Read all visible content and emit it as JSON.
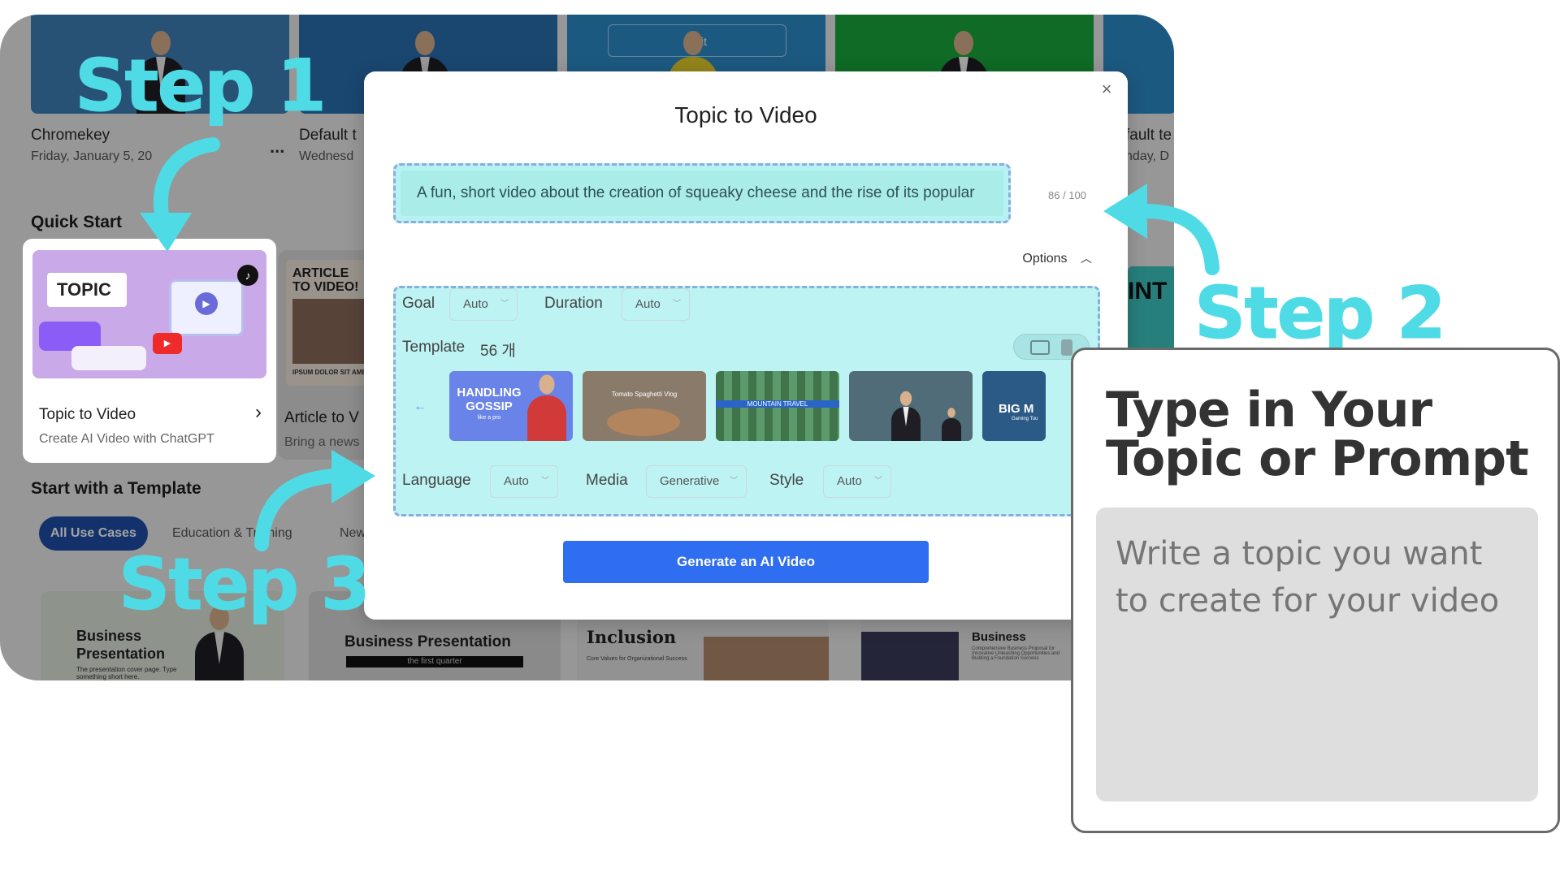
{
  "app": {
    "videos": [
      {
        "title": "Chromekey",
        "date": "Friday, January 5, 20"
      },
      {
        "title": "Default t",
        "date": "Wednesd"
      },
      {
        "title": "fault te",
        "date": "nday, D"
      }
    ],
    "more_label": "...",
    "thumb_edit_label": "Edit",
    "quick_start_title": "Quick Start",
    "quick_cards": [
      {
        "title": "Topic to Video",
        "subtitle": "Create AI Video with ChatGPT",
        "thumb_text": "TOPIC"
      },
      {
        "title": "Article to V",
        "subtitle": "Bring a news",
        "thumb_text": "ARTICLE TO VIDEO!",
        "thumb_caption": "IPSUM DOLOR SIT AME"
      }
    ],
    "side_card_text": "INT",
    "template_section_title": "Start with a Template",
    "template_tabs": [
      "All Use Cases",
      "Education & Training",
      "New"
    ],
    "template_cards": [
      {
        "title": "Business Presentation",
        "subtitle": "The presentation cover page. Type something short here."
      },
      {
        "title": "Business Presentation",
        "subtitle": "the first quarter"
      },
      {
        "title": "Inclusion",
        "subtitle": "Core Values for Organizational Success"
      },
      {
        "title": "Business",
        "subtitle": "Comprehensive Business Proposal for Innovative Unleashing Opportunities and Building a Foundation Success"
      }
    ]
  },
  "steps": {
    "step1": "Step 1",
    "step2": "Step 2",
    "step3": "Step 3"
  },
  "modal": {
    "title": "Topic to Video",
    "close_icon": "×",
    "prompt_text": "A fun, short video about the creation of squeaky cheese and the rise of its popular",
    "char_count": "86 / 100",
    "options_label": "Options",
    "goal_label": "Goal",
    "goal_value": "Auto",
    "duration_label": "Duration",
    "duration_value": "Auto",
    "template_label": "Template",
    "template_count": "56 개",
    "templates": [
      {
        "label": "HANDLING GOSSIP",
        "sub": "like a pro",
        "color": "#6a83e8"
      },
      {
        "label": "Tomato Spaghetti Vlog",
        "color": "#8a7a6a"
      },
      {
        "label": "MOUNTAIN TRAVEL",
        "color": "#4e8a5e"
      },
      {
        "label": "",
        "color": "#4f6c78"
      },
      {
        "label": "BIG M",
        "sub": "Gaming Tou",
        "color": "#2b5a86"
      }
    ],
    "language_label": "Language",
    "language_value": "Auto",
    "media_label": "Media",
    "media_value": "Generative",
    "style_label": "Style",
    "style_value": "Auto",
    "generate_label": "Generate an AI Video"
  },
  "callout": {
    "title": "Type in Your Topic or Prompt",
    "placeholder": "Write a topic you want to create for your video"
  },
  "colors": {
    "step_cyan": "#4fdbe6",
    "primary_blue": "#2f6ef0",
    "highlight": "#b8f1f4"
  }
}
